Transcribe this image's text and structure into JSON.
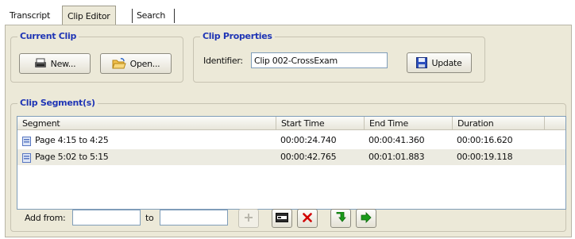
{
  "tabs": [
    {
      "label": "Transcript",
      "active": false
    },
    {
      "label": "Clip Editor",
      "active": true
    },
    {
      "label": "Search",
      "active": false
    }
  ],
  "current_clip": {
    "title": "Current Clip",
    "new_label": "New...",
    "open_label": "Open..."
  },
  "clip_properties": {
    "title": "Clip Properties",
    "identifier_label": "Identifier:",
    "identifier_value": "Clip 002-CrossExam",
    "update_label": "Update"
  },
  "segments": {
    "title": "Clip Segment(s)",
    "columns": [
      "Segment",
      "Start Time",
      "End Time",
      "Duration"
    ],
    "rows": [
      {
        "segment": "Page 4:15 to 4:25",
        "start": "00:00:24.740",
        "end": "00:00:41.360",
        "duration": "00:00:16.620",
        "selected": false
      },
      {
        "segment": "Page 5:02 to 5:15",
        "start": "00:00:42.765",
        "end": "00:01:01.883",
        "duration": "00:00:19.118",
        "selected": true
      }
    ]
  },
  "add_bar": {
    "from_label": "Add from:",
    "to_label": "to",
    "from_value": "",
    "to_value": ""
  },
  "icons": {
    "add": "plus-icon",
    "edit": "edit-segment-icon",
    "delete": "delete-x-icon",
    "move_down": "move-down-arrow-icon",
    "move_right": "move-right-arrow-icon"
  },
  "colors": {
    "group_title": "#1f35b5",
    "delete_red": "#d10000",
    "arrow_green": "#1a9a1a",
    "selected_row": "#ecebe1"
  }
}
